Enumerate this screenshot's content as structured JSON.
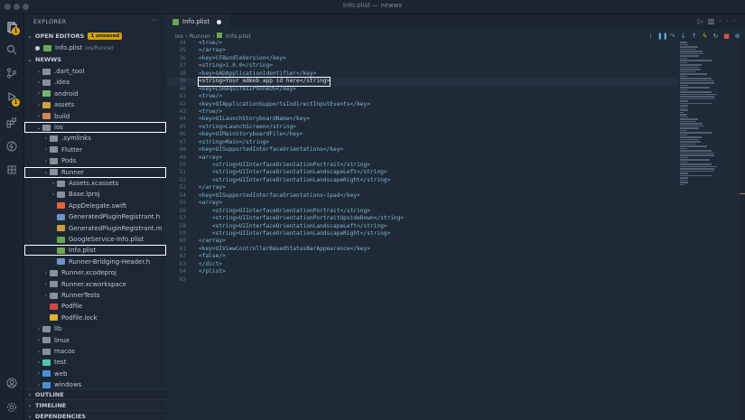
{
  "window": {
    "title": "Info.plist — newws"
  },
  "activity": {
    "badge_count": "1",
    "debug_badge": "1"
  },
  "sidebar": {
    "header": "EXPLORER",
    "open_editors_label": "OPEN EDITORS",
    "unsaved_badge": "1 unsaved",
    "open_file": {
      "name": "Info.plist",
      "path": "ios/Runner"
    },
    "workspace_label": "NEWWS",
    "tree": [
      {
        "label": ".dart_tool",
        "indent": 1,
        "chev": "›",
        "color": "#8a8f98"
      },
      {
        "label": ".idea",
        "indent": 1,
        "chev": "›",
        "color": "#8a8f98"
      },
      {
        "label": "android",
        "indent": 1,
        "chev": "›",
        "color": "#78b26d"
      },
      {
        "label": "assets",
        "indent": 1,
        "chev": "›",
        "color": "#d6a243"
      },
      {
        "label": "build",
        "indent": 1,
        "chev": "›",
        "color": "#d08a4a"
      },
      {
        "label": "ios",
        "indent": 1,
        "chev": "⌄",
        "color": "#8a8f98"
      },
      {
        "label": ".symlinks",
        "indent": 2,
        "chev": "›",
        "color": "#8a8f98"
      },
      {
        "label": "Flutter",
        "indent": 2,
        "chev": "›",
        "color": "#8a8f98"
      },
      {
        "label": "Pods",
        "indent": 2,
        "chev": "›",
        "color": "#8a8f98"
      },
      {
        "label": "Runner",
        "indent": 2,
        "chev": "⌄",
        "color": "#8a8f98"
      },
      {
        "label": "Assets.xcassets",
        "indent": 3,
        "chev": "›",
        "color": "#8a8f98"
      },
      {
        "label": "Base.lproj",
        "indent": 3,
        "chev": "›",
        "color": "#8a8f98"
      },
      {
        "label": "AppDelegate.swift",
        "indent": 3,
        "chev": "",
        "color": "#e5603b"
      },
      {
        "label": "GeneratedPluginRegistrant.h",
        "indent": 3,
        "chev": "",
        "color": "#6a94c9"
      },
      {
        "label": "GeneratedPluginRegistrant.m",
        "indent": 3,
        "chev": "",
        "color": "#d09b3c"
      },
      {
        "label": "GoogleService-Info.plist",
        "indent": 3,
        "chev": "",
        "color": "#6aa84f"
      },
      {
        "label": "Info.plist",
        "indent": 3,
        "chev": "",
        "color": "#6aa84f"
      },
      {
        "label": "Runner-Bridging-Header.h",
        "indent": 3,
        "chev": "",
        "color": "#6a94c9"
      },
      {
        "label": "Runner.xcodeproj",
        "indent": 2,
        "chev": "›",
        "color": "#8a8f98"
      },
      {
        "label": "Runner.xcworkspace",
        "indent": 2,
        "chev": "›",
        "color": "#8a8f98"
      },
      {
        "label": "RunnerTests",
        "indent": 2,
        "chev": "›",
        "color": "#8a8f98"
      },
      {
        "label": "Podfile",
        "indent": 2,
        "chev": "",
        "color": "#d6463b"
      },
      {
        "label": "Podfile.lock",
        "indent": 2,
        "chev": "",
        "color": "#e0b030"
      },
      {
        "label": "lib",
        "indent": 1,
        "chev": "›",
        "color": "#8a8f98"
      },
      {
        "label": "linux",
        "indent": 1,
        "chev": "›",
        "color": "#8a8f98"
      },
      {
        "label": "macos",
        "indent": 1,
        "chev": "›",
        "color": "#8a8f98"
      },
      {
        "label": "test",
        "indent": 1,
        "chev": "›",
        "color": "#4ec9b0"
      },
      {
        "label": "web",
        "indent": 1,
        "chev": "›",
        "color": "#4d8fd6"
      },
      {
        "label": "windows",
        "indent": 1,
        "chev": "›",
        "color": "#4d8fd6"
      }
    ],
    "outline_label": "OUTLINE",
    "timeline_label": "TIMELINE",
    "dependencies_label": "DEPENDENCIES"
  },
  "editor": {
    "tab_label": "Info.plist",
    "breadcrumb": [
      "ios",
      "Runner",
      "Info.plist"
    ],
    "highlighted_line": "39",
    "lines": [
      {
        "n": "34",
        "t": "<true/>"
      },
      {
        "n": "35",
        "t": "</array>"
      },
      {
        "n": "36",
        "t": "<key>CFBundleVersion</key>"
      },
      {
        "n": "37",
        "t": "<string>1.0.0</string>"
      },
      {
        "n": "38",
        "t": "<key>GADApplicationIdentifier</key>"
      },
      {
        "n": "39",
        "t": "<string>Your admob app id here</string>"
      },
      {
        "n": "40",
        "t": "<key>LSRequiresIPhoneOS</key>"
      },
      {
        "n": "41",
        "t": "<true/>"
      },
      {
        "n": "42",
        "t": "<key>UIApplicationSupportsIndirectInputEvents</key>"
      },
      {
        "n": "43",
        "t": "<true/>"
      },
      {
        "n": "44",
        "t": "<key>UILaunchStoryboardName</key>"
      },
      {
        "n": "45",
        "t": "<string>LaunchScreen</string>"
      },
      {
        "n": "46",
        "t": "<key>UIMainStoryboardFile</key>"
      },
      {
        "n": "47",
        "t": "<string>Main</string>"
      },
      {
        "n": "48",
        "t": "<key>UISupportedInterfaceOrientations</key>"
      },
      {
        "n": "49",
        "t": "<array>"
      },
      {
        "n": "50",
        "t": "    <string>UIInterfaceOrientationPortrait</string>"
      },
      {
        "n": "51",
        "t": "    <string>UIInterfaceOrientationLandscapeLeft</string>"
      },
      {
        "n": "52",
        "t": "    <string>UIInterfaceOrientationLandscapeRight</string>"
      },
      {
        "n": "53",
        "t": "</array>"
      },
      {
        "n": "54",
        "t": "<key>UISupportedInterfaceOrientations~ipad</key>"
      },
      {
        "n": "55",
        "t": "<array>"
      },
      {
        "n": "56",
        "t": "    <string>UIInterfaceOrientationPortrait</string>"
      },
      {
        "n": "57",
        "t": "    <string>UIInterfaceOrientationPortraitUpsideDown</string>"
      },
      {
        "n": "58",
        "t": "    <string>UIInterfaceOrientationLandscapeLeft</string>"
      },
      {
        "n": "59",
        "t": "    <string>UIInterfaceOrientationLandscapeRight</string>"
      },
      {
        "n": "60",
        "t": "</array>"
      },
      {
        "n": "61",
        "t": "<key>UIViewControllerBasedStatusBarAppearance</key>"
      },
      {
        "n": "62",
        "t": "<false/>"
      },
      {
        "n": "63",
        "t": "</dict>"
      },
      {
        "n": "64",
        "t": "</plist>"
      },
      {
        "n": "65",
        "t": ""
      }
    ]
  },
  "colors": {
    "accent": "#e0a800",
    "background": "#1e2a36",
    "highlight_box": "#ffffff"
  }
}
